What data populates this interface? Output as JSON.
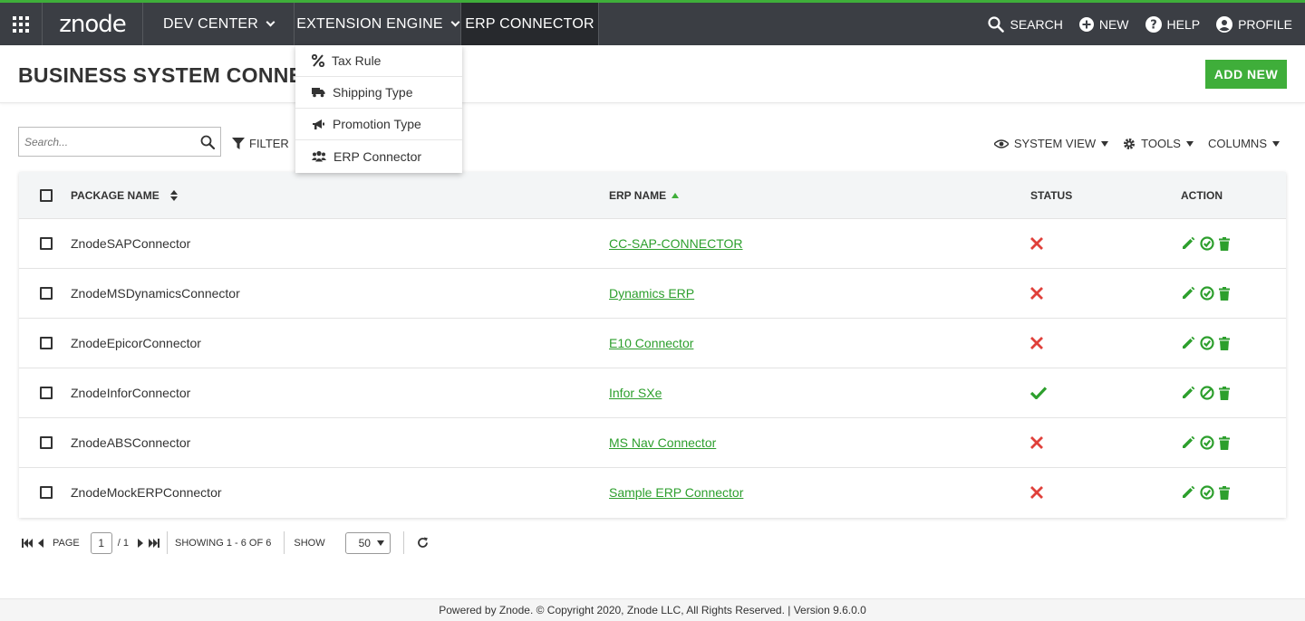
{
  "nav": {
    "logo": "znode",
    "items": [
      {
        "label": "DEV CENTER"
      },
      {
        "label": "EXTENSION ENGINE"
      },
      {
        "label": "ERP CONNECTOR"
      }
    ],
    "right": {
      "search": "SEARCH",
      "new": "NEW",
      "help": "HELP",
      "profile": "PROFILE"
    }
  },
  "dropdown": {
    "items": [
      {
        "label": "Tax Rule",
        "icon": "percent-icon"
      },
      {
        "label": "Shipping Type",
        "icon": "truck-icon"
      },
      {
        "label": "Promotion Type",
        "icon": "megaphone-icon"
      },
      {
        "label": "ERP Connector",
        "icon": "users-icon"
      }
    ]
  },
  "page": {
    "title": "BUSINESS SYSTEM CONNECTOR",
    "add_new": "ADD NEW"
  },
  "toolbar": {
    "search_placeholder": "Search...",
    "filter": "FILTER",
    "system_view": "SYSTEM VIEW",
    "tools": "TOOLS",
    "columns": "COLUMNS"
  },
  "table": {
    "headers": {
      "package_name": "PACKAGE NAME",
      "erp_name": "ERP NAME",
      "status": "STATUS",
      "action": "ACTION"
    },
    "rows": [
      {
        "package": "ZnodeSAPConnector",
        "erp": "CC-SAP-CONNECTOR",
        "status": "inactive"
      },
      {
        "package": "ZnodeMSDynamicsConnector",
        "erp": "Dynamics ERP",
        "status": "inactive"
      },
      {
        "package": "ZnodeEpicorConnector",
        "erp": "E10 Connector",
        "status": "inactive"
      },
      {
        "package": "ZnodeInforConnector",
        "erp": "Infor SXe",
        "status": "active"
      },
      {
        "package": "ZnodeABSConnector",
        "erp": "MS Nav Connector",
        "status": "inactive"
      },
      {
        "package": "ZnodeMockERPConnector",
        "erp": "Sample ERP Connector",
        "status": "inactive"
      }
    ]
  },
  "pager": {
    "page_label": "PAGE",
    "page_value": "1",
    "page_total": "/ 1",
    "showing": "SHOWING 1 - 6 OF 6",
    "show_label": "SHOW",
    "show_value": "50"
  },
  "footer": {
    "text": "Powered by Znode. © Copyright 2020, Znode LLC, All Rights Reserved. | Version 9.6.0.0"
  },
  "colors": {
    "accent": "#3fae3a",
    "nav_bg": "#3b3e44",
    "danger": "#e0403a"
  }
}
